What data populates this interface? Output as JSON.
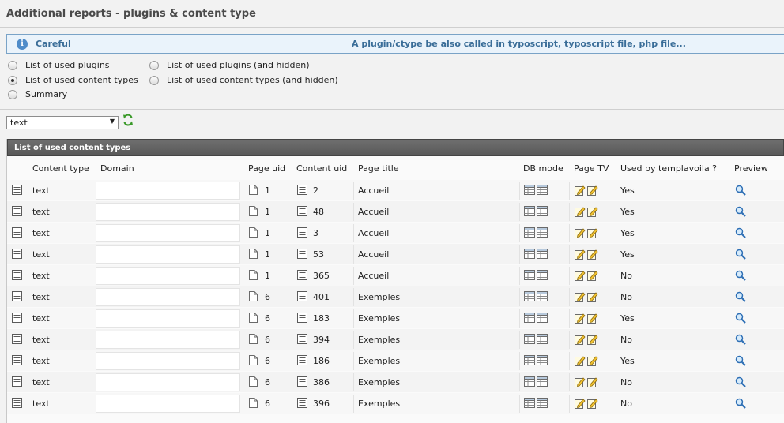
{
  "page": {
    "title": "Additional reports - plugins & content type"
  },
  "info": {
    "title": "Careful",
    "message": "A plugin/ctype be also called in typoscript, typoscript file, php file...",
    "icon": "info-icon"
  },
  "options": [
    {
      "label": "List of used plugins",
      "checked": false
    },
    {
      "label": "List of used content types",
      "checked": true
    },
    {
      "label": "Summary",
      "checked": false
    },
    {
      "label": "List of used plugins (and hidden)",
      "checked": false
    },
    {
      "label": "List of used content types (and hidden)",
      "checked": false
    }
  ],
  "filter": {
    "selected": "text"
  },
  "table": {
    "title": "List of used content types",
    "headers": {
      "content_type": "Content type",
      "domain": "Domain",
      "page_uid": "Page uid",
      "content_uid": "Content uid",
      "page_title": "Page title",
      "db_mode": "DB mode",
      "page_tv": "Page TV",
      "used_by": "Used by templavoila ?",
      "preview": "Preview"
    },
    "rows": [
      {
        "ctype": "text",
        "domain": "",
        "page_uid": "1",
        "content_uid": "2",
        "page_title": "Accueil",
        "used": "Yes"
      },
      {
        "ctype": "text",
        "domain": "",
        "page_uid": "1",
        "content_uid": "48",
        "page_title": "Accueil",
        "used": "Yes"
      },
      {
        "ctype": "text",
        "domain": "",
        "page_uid": "1",
        "content_uid": "3",
        "page_title": "Accueil",
        "used": "Yes"
      },
      {
        "ctype": "text",
        "domain": "",
        "page_uid": "1",
        "content_uid": "53",
        "page_title": "Accueil",
        "used": "Yes"
      },
      {
        "ctype": "text",
        "domain": "",
        "page_uid": "1",
        "content_uid": "365",
        "page_title": "Accueil",
        "used": "No"
      },
      {
        "ctype": "text",
        "domain": "",
        "page_uid": "6",
        "content_uid": "401",
        "page_title": "Exemples",
        "used": "No"
      },
      {
        "ctype": "text",
        "domain": "",
        "page_uid": "6",
        "content_uid": "183",
        "page_title": "Exemples",
        "used": "Yes"
      },
      {
        "ctype": "text",
        "domain": "",
        "page_uid": "6",
        "content_uid": "394",
        "page_title": "Exemples",
        "used": "No"
      },
      {
        "ctype": "text",
        "domain": "",
        "page_uid": "6",
        "content_uid": "186",
        "page_title": "Exemples",
        "used": "Yes"
      },
      {
        "ctype": "text",
        "domain": "",
        "page_uid": "6",
        "content_uid": "386",
        "page_title": "Exemples",
        "used": "No"
      },
      {
        "ctype": "text",
        "domain": "",
        "page_uid": "6",
        "content_uid": "396",
        "page_title": "Exemples",
        "used": "No"
      }
    ]
  }
}
